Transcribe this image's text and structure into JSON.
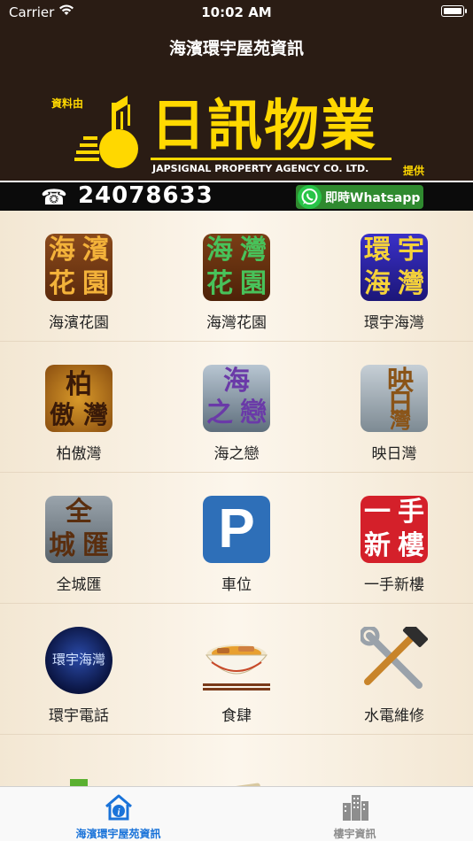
{
  "status": {
    "carrier": "Carrier",
    "time": "10:02 AM"
  },
  "nav": {
    "title": "海濱環宇屋苑資訊"
  },
  "banner": {
    "provided_by": "資料由",
    "company_cn": "日訊物業",
    "company_en": "JAPSIGNAL PROPERTY AGENCY CO. LTD.",
    "provide": "提供"
  },
  "contact": {
    "phone_icon": "telephone-icon",
    "phone": "24078633",
    "whatsapp_label": "即時Whatsapp"
  },
  "grid": {
    "items": [
      {
        "label": "海濱花園",
        "icon": "haibin-garden-icon",
        "glyphs": [
          "海",
          "濱",
          "花",
          "園"
        ]
      },
      {
        "label": "海灣花園",
        "icon": "haiwan-garden-icon",
        "glyphs": [
          "海",
          "灣",
          "花",
          "園"
        ]
      },
      {
        "label": "環宇海灣",
        "icon": "ocean-pride-icon",
        "glyphs": [
          "環",
          "宇",
          "海",
          "灣"
        ]
      },
      {
        "label": "柏傲灣",
        "icon": "parkview-bay-icon",
        "glyphs": [
          "柏",
          "傲",
          "灣"
        ]
      },
      {
        "label": "海之戀",
        "icon": "sea-love-icon",
        "glyphs": [
          "海",
          "之",
          "戀"
        ]
      },
      {
        "label": "映日灣",
        "icon": "sunrise-bay-icon",
        "glyphs": [
          "映",
          "日",
          "灣"
        ]
      },
      {
        "label": "全城匯",
        "icon": "city-point-icon",
        "glyphs": [
          "全",
          "城",
          "匯"
        ]
      },
      {
        "label": "車位",
        "icon": "parking-icon",
        "glyphs": [
          "P"
        ]
      },
      {
        "label": "一手新樓",
        "icon": "new-flat-icon",
        "glyphs": [
          "一",
          "手",
          "新",
          "樓"
        ]
      },
      {
        "label": "環宇電話",
        "icon": "phone-directory-icon",
        "glyphs": [
          "環宇海灣"
        ]
      },
      {
        "label": "食肆",
        "icon": "noodle-bowl-icon",
        "glyphs": []
      },
      {
        "label": "水電維修",
        "icon": "tools-icon",
        "glyphs": []
      }
    ]
  },
  "tabs": [
    {
      "label": "海濱環宇屋苑資訊",
      "icon": "home-info-icon",
      "active": true
    },
    {
      "label": "樓宇資訊",
      "icon": "buildings-icon",
      "active": false
    }
  ],
  "colors": {
    "nav_bg": "#2a1c14",
    "brand_yellow": "#ffd800",
    "tab_active": "#1a73d9",
    "tab_inactive": "#8e8e8e",
    "whatsapp_green": "#2f8a2f"
  }
}
